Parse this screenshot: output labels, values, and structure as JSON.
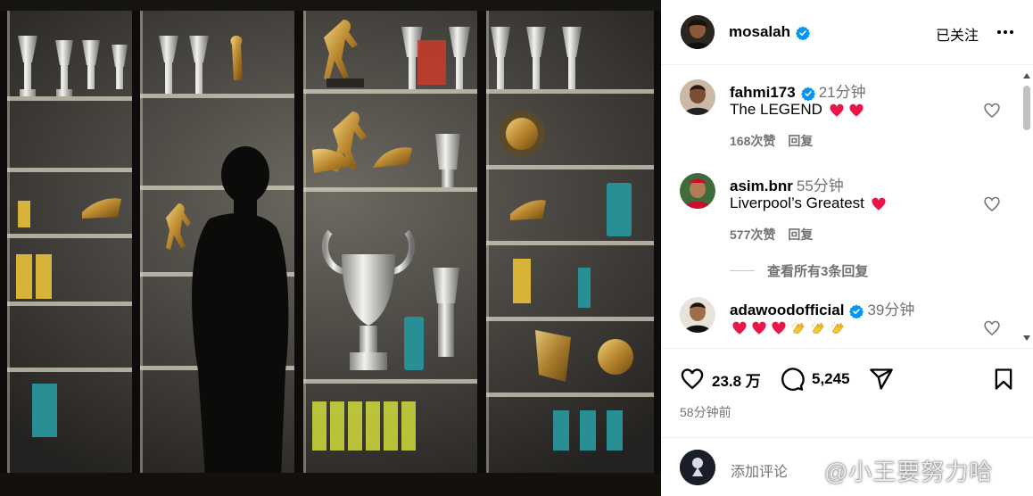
{
  "post": {
    "author": "mosalah",
    "follow_label": "已关注",
    "more_icon": "more-horizontal-icon"
  },
  "comments": [
    {
      "user": "fahmi173",
      "time": "21分钟",
      "text": "The LEGEND",
      "emojis": [
        "red-heart",
        "red-heart"
      ],
      "likes": "168次赞",
      "reply": "回复"
    },
    {
      "user": "asim.bnr",
      "time": "55分钟",
      "text": "Liverpool’s Greatest",
      "emojis": [
        "red-heart"
      ],
      "likes": "577次赞",
      "reply": "回复"
    },
    {
      "user": "adawoodofficial",
      "time": "39分钟",
      "text": "",
      "emojis": [
        "red-heart",
        "red-heart",
        "red-heart",
        "clapping-hands",
        "clapping-hands",
        "clapping-hands"
      ]
    }
  ],
  "view_replies": "查看所有3条回复",
  "actions": {
    "likes": "23.8 万",
    "comments": "5,245"
  },
  "post_time": "58分钟前",
  "comment_box": {
    "placeholder": "添加评论"
  },
  "watermark": "@小王要努力哈",
  "colors": {
    "verified": "#0095f6",
    "heart": "#ed4956",
    "muted": "#737373"
  }
}
